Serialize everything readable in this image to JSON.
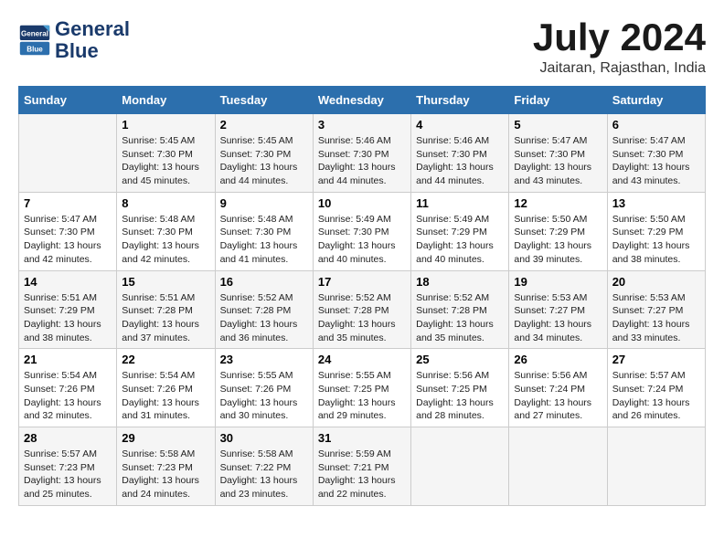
{
  "header": {
    "logo_line1": "General",
    "logo_line2": "Blue",
    "month_year": "July 2024",
    "location": "Jaitaran, Rajasthan, India"
  },
  "days_of_week": [
    "Sunday",
    "Monday",
    "Tuesday",
    "Wednesday",
    "Thursday",
    "Friday",
    "Saturday"
  ],
  "weeks": [
    [
      {
        "day": "",
        "info": ""
      },
      {
        "day": "1",
        "info": "Sunrise: 5:45 AM\nSunset: 7:30 PM\nDaylight: 13 hours\nand 45 minutes."
      },
      {
        "day": "2",
        "info": "Sunrise: 5:45 AM\nSunset: 7:30 PM\nDaylight: 13 hours\nand 44 minutes."
      },
      {
        "day": "3",
        "info": "Sunrise: 5:46 AM\nSunset: 7:30 PM\nDaylight: 13 hours\nand 44 minutes."
      },
      {
        "day": "4",
        "info": "Sunrise: 5:46 AM\nSunset: 7:30 PM\nDaylight: 13 hours\nand 44 minutes."
      },
      {
        "day": "5",
        "info": "Sunrise: 5:47 AM\nSunset: 7:30 PM\nDaylight: 13 hours\nand 43 minutes."
      },
      {
        "day": "6",
        "info": "Sunrise: 5:47 AM\nSunset: 7:30 PM\nDaylight: 13 hours\nand 43 minutes."
      }
    ],
    [
      {
        "day": "7",
        "info": "Sunrise: 5:47 AM\nSunset: 7:30 PM\nDaylight: 13 hours\nand 42 minutes."
      },
      {
        "day": "8",
        "info": "Sunrise: 5:48 AM\nSunset: 7:30 PM\nDaylight: 13 hours\nand 42 minutes."
      },
      {
        "day": "9",
        "info": "Sunrise: 5:48 AM\nSunset: 7:30 PM\nDaylight: 13 hours\nand 41 minutes."
      },
      {
        "day": "10",
        "info": "Sunrise: 5:49 AM\nSunset: 7:30 PM\nDaylight: 13 hours\nand 40 minutes."
      },
      {
        "day": "11",
        "info": "Sunrise: 5:49 AM\nSunset: 7:29 PM\nDaylight: 13 hours\nand 40 minutes."
      },
      {
        "day": "12",
        "info": "Sunrise: 5:50 AM\nSunset: 7:29 PM\nDaylight: 13 hours\nand 39 minutes."
      },
      {
        "day": "13",
        "info": "Sunrise: 5:50 AM\nSunset: 7:29 PM\nDaylight: 13 hours\nand 38 minutes."
      }
    ],
    [
      {
        "day": "14",
        "info": "Sunrise: 5:51 AM\nSunset: 7:29 PM\nDaylight: 13 hours\nand 38 minutes."
      },
      {
        "day": "15",
        "info": "Sunrise: 5:51 AM\nSunset: 7:28 PM\nDaylight: 13 hours\nand 37 minutes."
      },
      {
        "day": "16",
        "info": "Sunrise: 5:52 AM\nSunset: 7:28 PM\nDaylight: 13 hours\nand 36 minutes."
      },
      {
        "day": "17",
        "info": "Sunrise: 5:52 AM\nSunset: 7:28 PM\nDaylight: 13 hours\nand 35 minutes."
      },
      {
        "day": "18",
        "info": "Sunrise: 5:52 AM\nSunset: 7:28 PM\nDaylight: 13 hours\nand 35 minutes."
      },
      {
        "day": "19",
        "info": "Sunrise: 5:53 AM\nSunset: 7:27 PM\nDaylight: 13 hours\nand 34 minutes."
      },
      {
        "day": "20",
        "info": "Sunrise: 5:53 AM\nSunset: 7:27 PM\nDaylight: 13 hours\nand 33 minutes."
      }
    ],
    [
      {
        "day": "21",
        "info": "Sunrise: 5:54 AM\nSunset: 7:26 PM\nDaylight: 13 hours\nand 32 minutes."
      },
      {
        "day": "22",
        "info": "Sunrise: 5:54 AM\nSunset: 7:26 PM\nDaylight: 13 hours\nand 31 minutes."
      },
      {
        "day": "23",
        "info": "Sunrise: 5:55 AM\nSunset: 7:26 PM\nDaylight: 13 hours\nand 30 minutes."
      },
      {
        "day": "24",
        "info": "Sunrise: 5:55 AM\nSunset: 7:25 PM\nDaylight: 13 hours\nand 29 minutes."
      },
      {
        "day": "25",
        "info": "Sunrise: 5:56 AM\nSunset: 7:25 PM\nDaylight: 13 hours\nand 28 minutes."
      },
      {
        "day": "26",
        "info": "Sunrise: 5:56 AM\nSunset: 7:24 PM\nDaylight: 13 hours\nand 27 minutes."
      },
      {
        "day": "27",
        "info": "Sunrise: 5:57 AM\nSunset: 7:24 PM\nDaylight: 13 hours\nand 26 minutes."
      }
    ],
    [
      {
        "day": "28",
        "info": "Sunrise: 5:57 AM\nSunset: 7:23 PM\nDaylight: 13 hours\nand 25 minutes."
      },
      {
        "day": "29",
        "info": "Sunrise: 5:58 AM\nSunset: 7:23 PM\nDaylight: 13 hours\nand 24 minutes."
      },
      {
        "day": "30",
        "info": "Sunrise: 5:58 AM\nSunset: 7:22 PM\nDaylight: 13 hours\nand 23 minutes."
      },
      {
        "day": "31",
        "info": "Sunrise: 5:59 AM\nSunset: 7:21 PM\nDaylight: 13 hours\nand 22 minutes."
      },
      {
        "day": "",
        "info": ""
      },
      {
        "day": "",
        "info": ""
      },
      {
        "day": "",
        "info": ""
      }
    ]
  ]
}
